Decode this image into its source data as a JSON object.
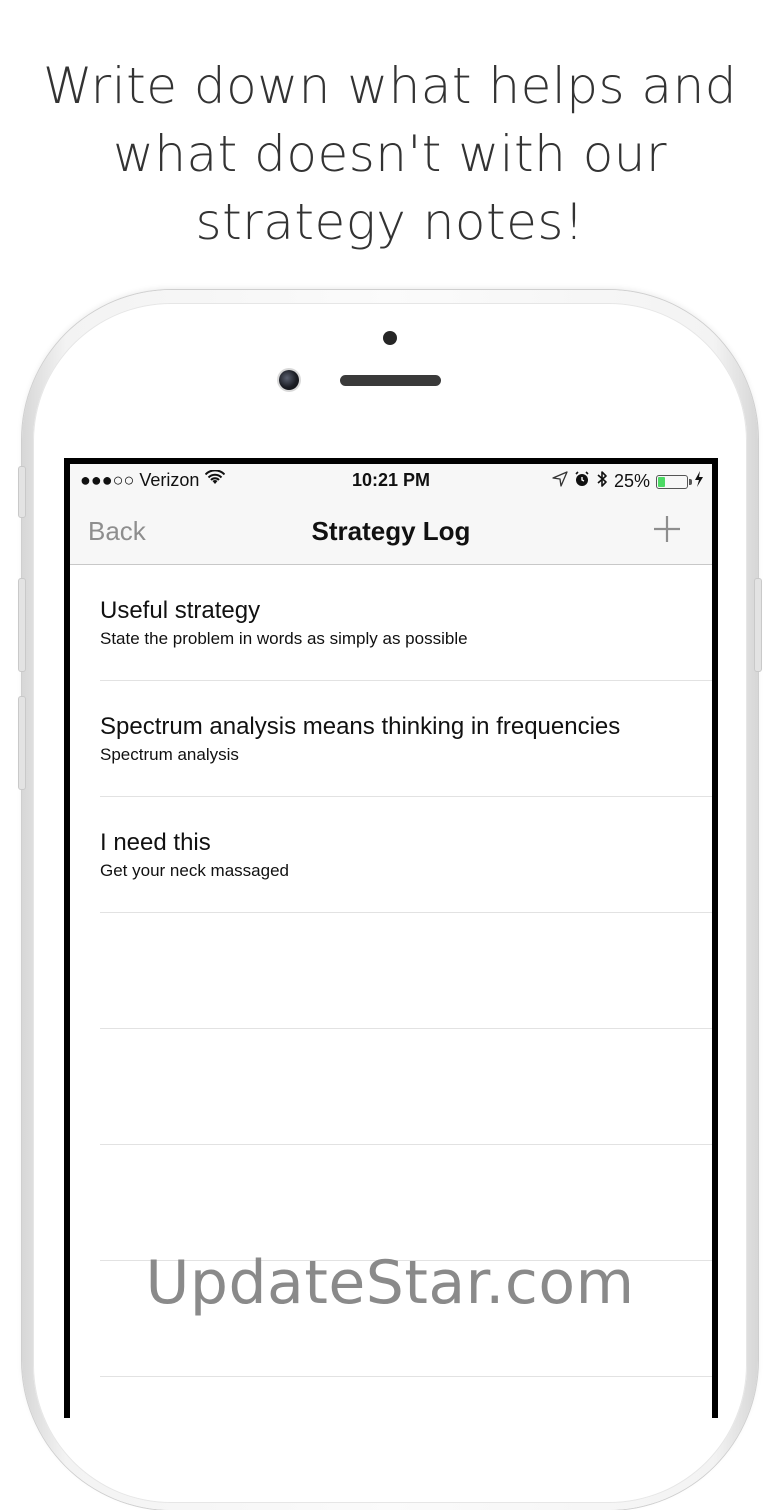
{
  "headline": "Write down what helps and what doesn't with our strategy notes!",
  "status_bar": {
    "carrier": "●●●○○ Verizon",
    "time": "10:21 PM",
    "battery_percent": "25%",
    "battery_level": 0.25,
    "battery_color": "#4cd964"
  },
  "nav_bar": {
    "back_label": "Back",
    "title": "Strategy Log",
    "add_icon": "plus-icon"
  },
  "list": {
    "items": [
      {
        "title": "Useful strategy",
        "subtitle": "State the problem in words as simply as possible"
      },
      {
        "title": "Spectrum analysis means thinking in frequencies",
        "subtitle": "Spectrum analysis"
      },
      {
        "title": "I need this",
        "subtitle": "Get your neck massaged"
      }
    ]
  },
  "watermark": "UpdateStar.com",
  "colors": {
    "back_text": "#8e8e8e",
    "headline_text": "#333333",
    "watermark_text": "#8a8a8a"
  }
}
